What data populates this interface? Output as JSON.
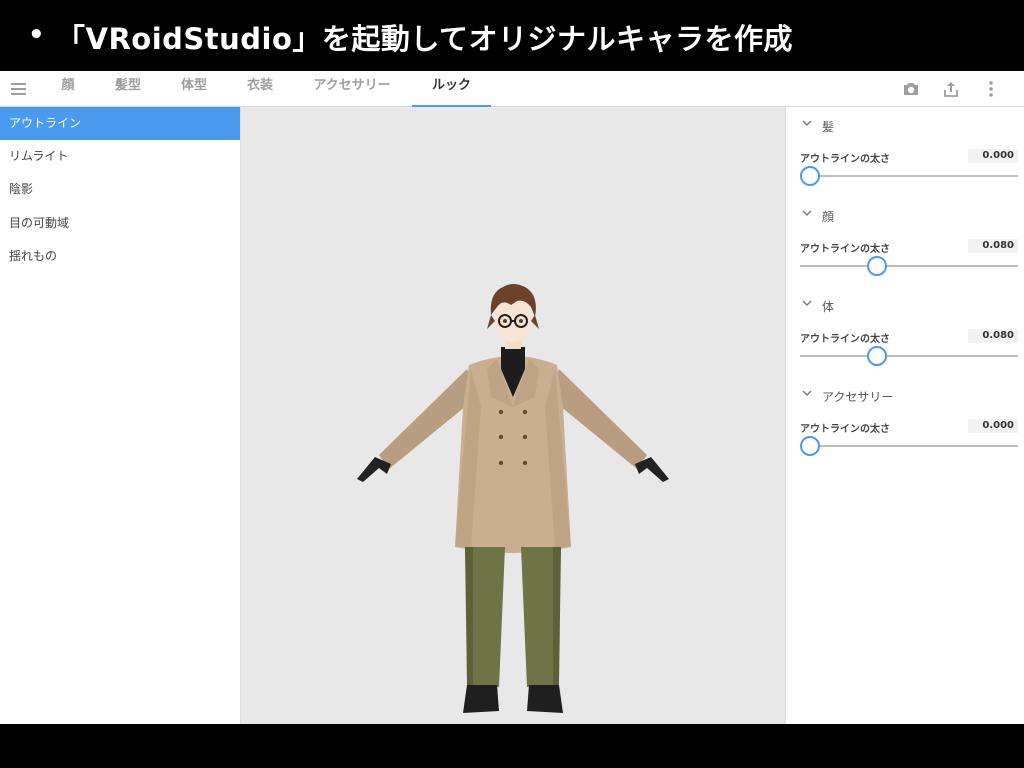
{
  "slide": {
    "bullet": "•",
    "title": "「VRoidStudio」を起動してオリジナルキャラを作成"
  },
  "topbar": {
    "menu_icon": "hamburger-menu-icon",
    "tabs": [
      {
        "label": "顔"
      },
      {
        "label": "髪型"
      },
      {
        "label": "体型"
      },
      {
        "label": "衣装"
      },
      {
        "label": "アクセサリー"
      },
      {
        "label": "ルック",
        "active": true
      }
    ],
    "icons": [
      "camera-icon",
      "share-upload-icon",
      "more-vertical-icon"
    ]
  },
  "sidebar": {
    "items": [
      {
        "label": "アウトライン",
        "active": true
      },
      {
        "label": "リムライト"
      },
      {
        "label": "陰影"
      },
      {
        "label": "目の可動域"
      },
      {
        "label": "揺れもの"
      }
    ]
  },
  "viewport": {
    "subject": "3D character model"
  },
  "properties": {
    "sections": [
      {
        "title": "髪",
        "prop_label": "アウトラインの太さ",
        "value": "0.000",
        "slider_fraction": 0.0
      },
      {
        "title": "顔",
        "prop_label": "アウトラインの太さ",
        "value": "0.080",
        "slider_fraction": 0.34
      },
      {
        "title": "体",
        "prop_label": "アウトラインの太さ",
        "value": "0.080",
        "slider_fraction": 0.34
      },
      {
        "title": "アクセサリー",
        "prop_label": "アウトラインの太さ",
        "value": "0.000",
        "slider_fraction": 0.0
      }
    ]
  },
  "colors": {
    "accent": "#4a9bef",
    "viewport_bg": "#e8e8e8",
    "coat": "#c9ae8f",
    "pants": "#6f7446"
  }
}
